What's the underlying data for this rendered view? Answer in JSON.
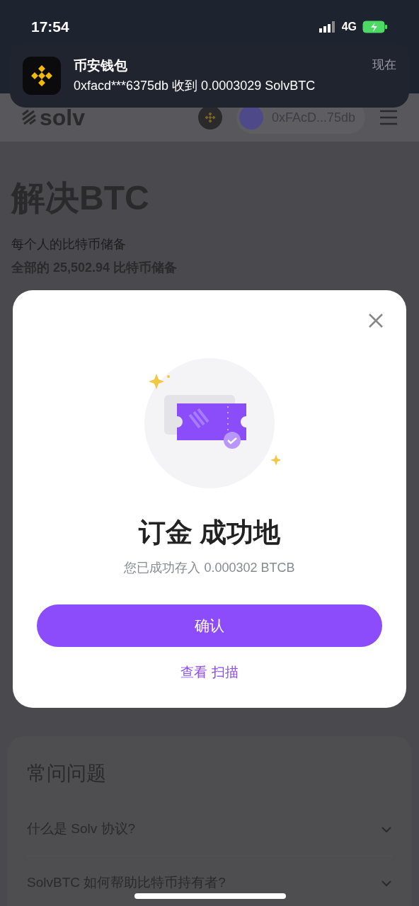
{
  "status_bar": {
    "time": "17:54",
    "network": "4G"
  },
  "notification": {
    "app": "币安钱包",
    "time": "现在",
    "message": "0xfacd***6375db 收到 0.0003029 SolvBTC"
  },
  "header": {
    "logo": "solv",
    "address": "0xFAcD...75db"
  },
  "hero": {
    "title": "解决BTC",
    "subtitle": "每个人的比特币储备",
    "total": "全部的 25,502.94 比特币储备"
  },
  "modal": {
    "title": "订金 成功地",
    "message": "您已成功存入 0.000302 BTCB",
    "confirm": "确认",
    "link": "查看 扫描"
  },
  "faq": {
    "title": "常问问题",
    "items": [
      {
        "question": "什么是 Solv 协议?",
        "expanded": false
      },
      {
        "question": "SolvBTC 如何帮助比特币持有者?",
        "expanded": false
      }
    ]
  }
}
